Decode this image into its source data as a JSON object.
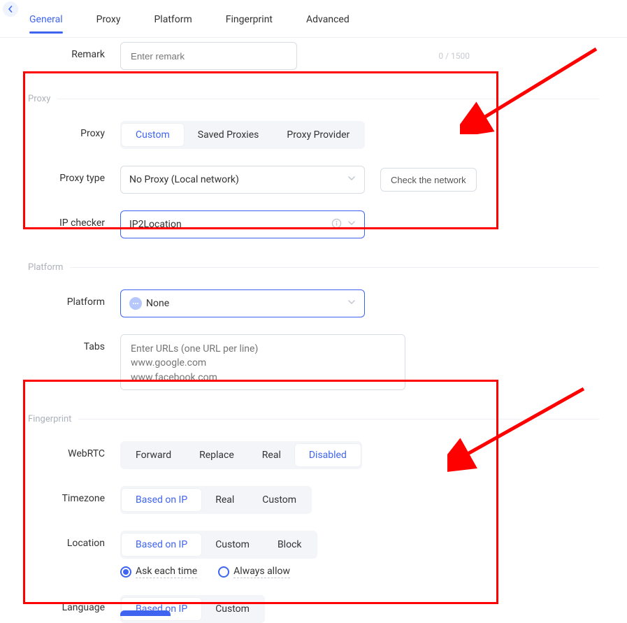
{
  "tabs": {
    "general": "General",
    "proxy": "Proxy",
    "platform": "Platform",
    "fingerprint": "Fingerprint",
    "advanced": "Advanced"
  },
  "remark": {
    "label": "Remark",
    "placeholder": "Enter remark",
    "counter": "0 / 1500"
  },
  "proxy": {
    "section": "Proxy",
    "label": "Proxy",
    "options": [
      "Custom",
      "Saved Proxies",
      "Proxy Provider"
    ],
    "type_label": "Proxy type",
    "type_value": "No Proxy (Local network)",
    "check_btn": "Check the network",
    "ipchecker_label": "IP checker",
    "ipchecker_value": "IP2Location"
  },
  "platform": {
    "section": "Platform",
    "label": "Platform",
    "value": "None",
    "tabs_label": "Tabs",
    "tabs_placeholder": "Enter URLs (one URL per line)\nwww.google.com\nwww.facebook.com"
  },
  "fingerprint": {
    "section": "Fingerprint",
    "webrtc_label": "WebRTC",
    "webrtc_options": [
      "Forward",
      "Replace",
      "Real",
      "Disabled"
    ],
    "timezone_label": "Timezone",
    "timezone_options": [
      "Based on IP",
      "Real",
      "Custom"
    ],
    "location_label": "Location",
    "location_options": [
      "Based on IP",
      "Custom",
      "Block"
    ],
    "location_radios": [
      "Ask each time",
      "Always allow"
    ],
    "language_label": "Language",
    "language_options": [
      "Based on IP",
      "Custom"
    ]
  }
}
